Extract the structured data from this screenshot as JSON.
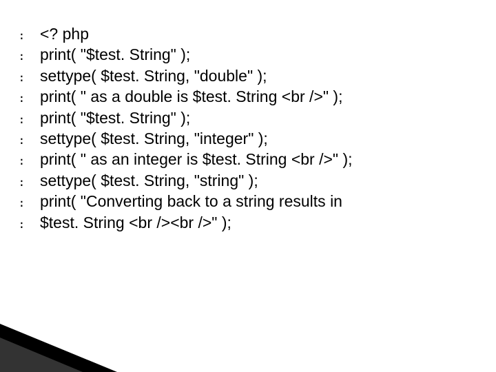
{
  "bullet_glyph": "։",
  "lines": [
    "<? php",
    "print( \"$test. String\" );",
    "settype( $test. String, \"double\" );",
    "print( \" as a double is $test. String <br />\" );",
    "print( \"$test. String\" );",
    "settype( $test. String, \"integer\" );",
    "print( \" as an integer is $test. String <br />\" );",
    "settype( $test. String, \"string\" );",
    "print( \"Converting back to a string results in",
    "$test. String <br /><br />\" );"
  ]
}
